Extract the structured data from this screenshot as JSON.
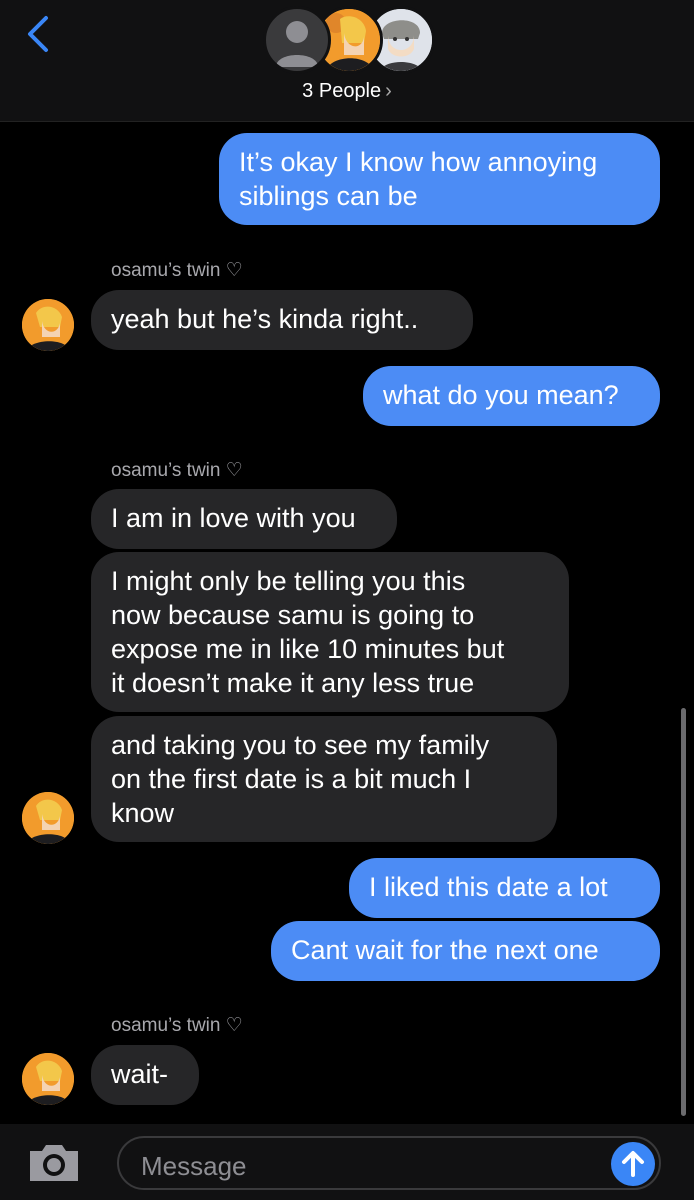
{
  "header": {
    "participants_label": "3 People",
    "chevron": "›"
  },
  "messages": [
    {
      "from": "me",
      "text_lines": [
        "It’s okay I know how annoying",
        "siblings can be"
      ]
    },
    {
      "from": "sender",
      "sender_name": "osamu’s twin ♡"
    },
    {
      "from": "them",
      "text_lines": [
        "yeah but he’s kinda right.."
      ]
    },
    {
      "from": "me",
      "text_lines": [
        "what do you mean?"
      ]
    },
    {
      "from": "sender",
      "sender_name": "osamu’s twin ♡"
    },
    {
      "from": "them",
      "text_lines": [
        "I am in love with you"
      ]
    },
    {
      "from": "them",
      "text_lines": [
        "I might only be telling you this",
        "now because samu is going to",
        "expose me in like 10 minutes but",
        "it doesn’t make it any less true"
      ]
    },
    {
      "from": "them",
      "text_lines": [
        "and taking you to see my family",
        "on the first date is a bit much I",
        "know"
      ]
    },
    {
      "from": "me",
      "text_lines": [
        "I liked this date a lot"
      ]
    },
    {
      "from": "me",
      "text_lines": [
        "Cant wait for the next one"
      ]
    },
    {
      "from": "sender",
      "sender_name": "osamu’s twin ♡"
    },
    {
      "from": "them",
      "text_lines": [
        "wait-"
      ]
    }
  ],
  "input": {
    "placeholder": "Message"
  },
  "icons": {
    "back": "chevron-left-icon",
    "camera": "camera-icon",
    "send": "arrow-up-icon"
  },
  "colors": {
    "outgoing_bubble": "#4c8cf5",
    "incoming_bubble": "#262628",
    "accent": "#3a86f6"
  }
}
